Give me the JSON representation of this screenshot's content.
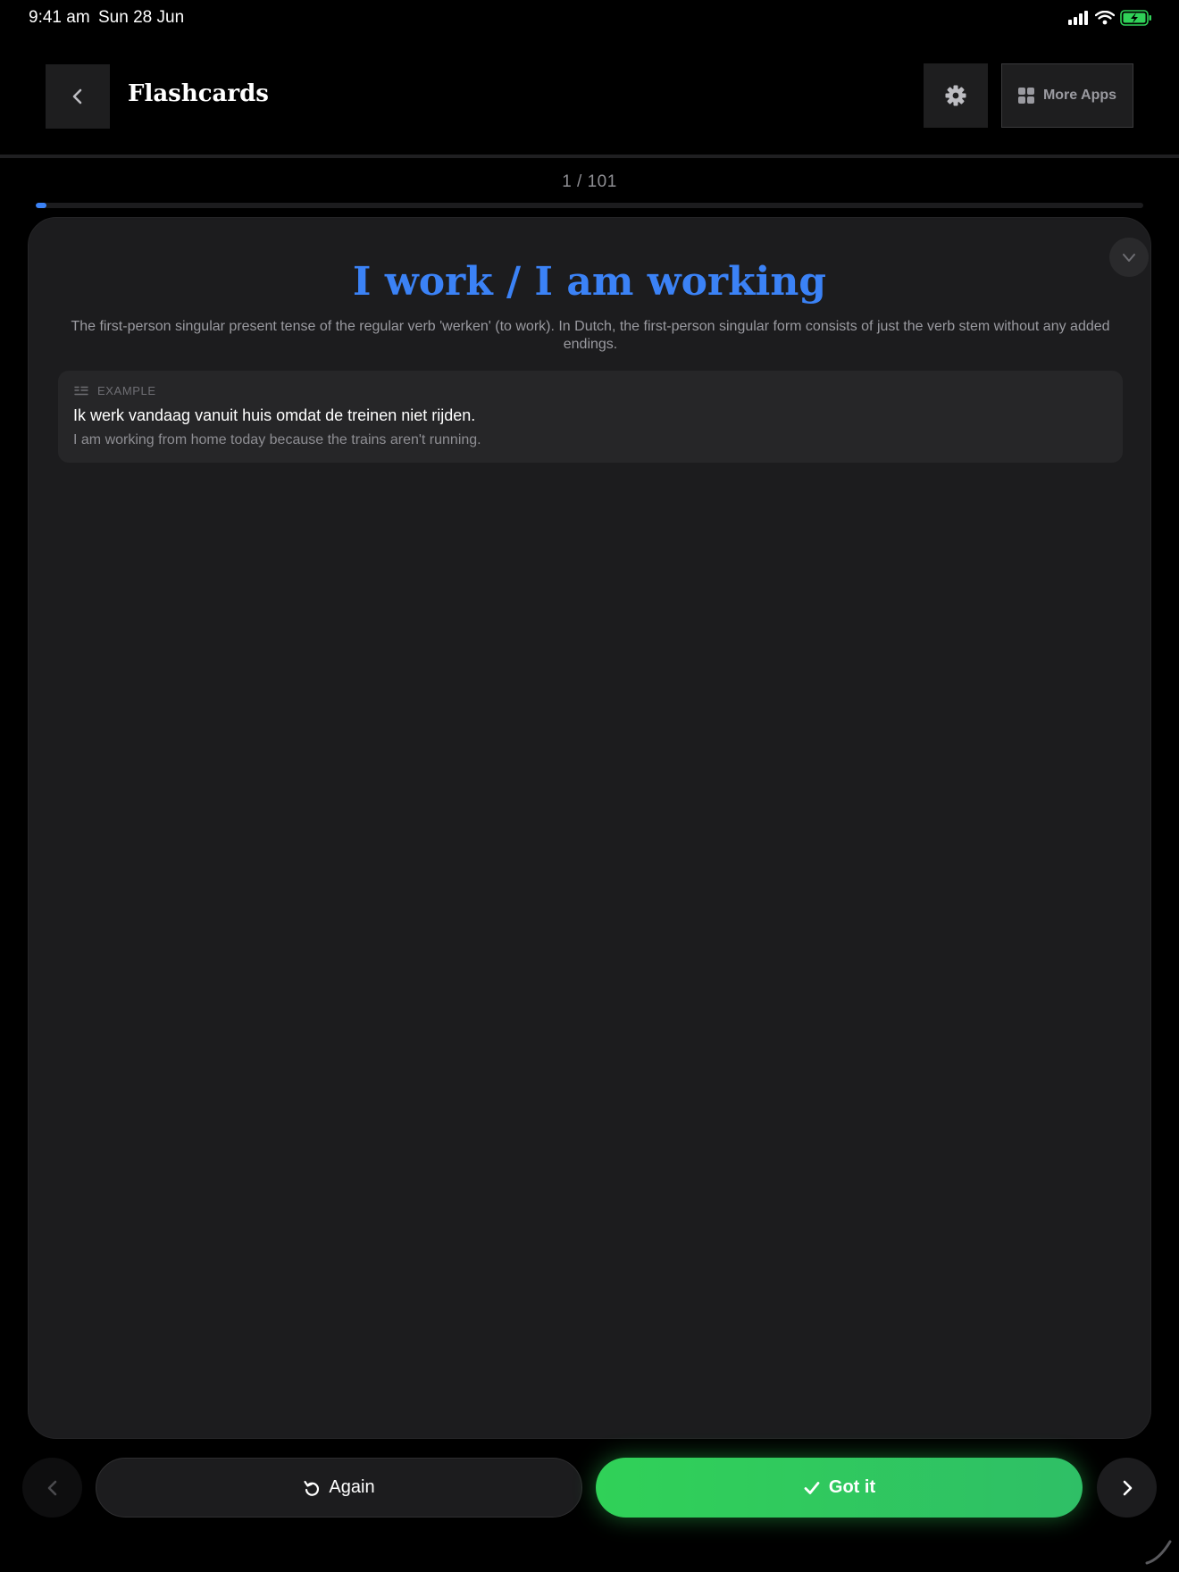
{
  "status_bar": {
    "time": "9:41 am",
    "date": "Sun 28 Jun",
    "icons": [
      "cellular-signal-icon",
      "wifi-icon",
      "battery-charging-icon"
    ]
  },
  "header": {
    "title": "Flashcards",
    "back_icon": "chevron-left-icon",
    "settings_icon": "gear-icon",
    "more_apps_icon": "grid-icon",
    "more_apps_label": "More Apps"
  },
  "progress": {
    "label": "1 / 101",
    "current": 1,
    "total": 101
  },
  "card": {
    "title": "I work / I am working",
    "description": "The first-person singular present tense of the regular verb 'werken' (to work). In Dutch, the first-person singular form consists of just the verb stem without any added endings.",
    "collapse_icon": "chevron-down-icon",
    "example": {
      "label": "EXAMPLE",
      "icon": "text-lines-icon",
      "sentence": "Ik werk vandaag vanuit huis omdat de treinen niet rijden.",
      "translation": "I am working from home today because the trains aren't running."
    }
  },
  "controls": {
    "prev_icon": "chevron-left-icon",
    "again_label": "Again",
    "again_icon": "rotate-ccw-icon",
    "gotit_label": "Got it",
    "gotit_icon": "checkmark-icon",
    "next_icon": "chevron-right-icon"
  },
  "colors": {
    "accent_blue": "#3b82f6",
    "success_green": "#30d158",
    "background": "#000000",
    "card_background": "#1c1c1e"
  }
}
